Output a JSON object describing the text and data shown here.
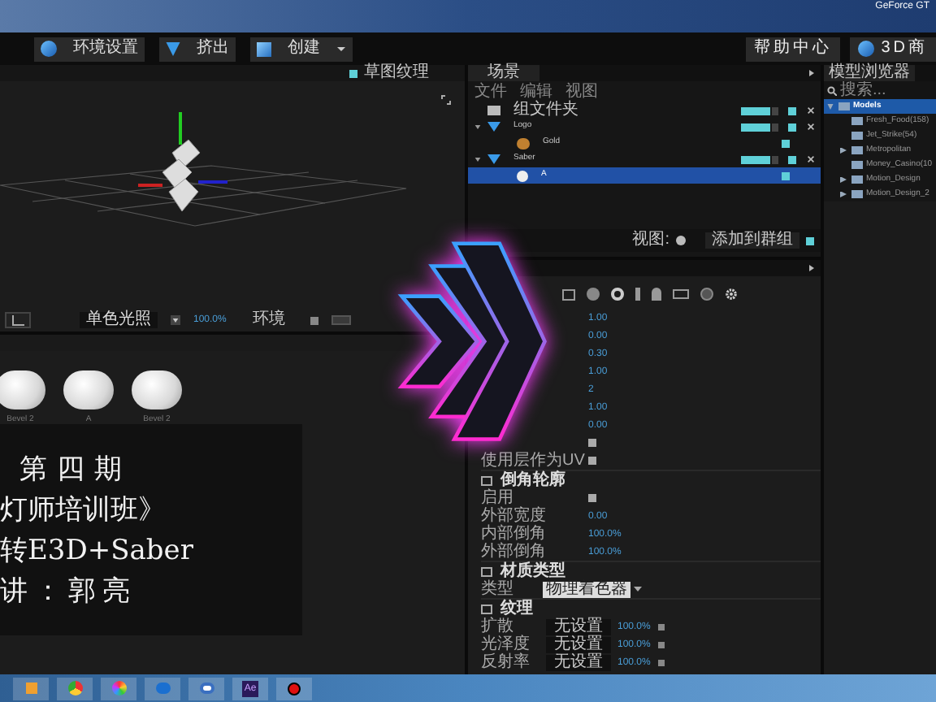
{
  "desktop": {
    "corner_text": "GeForce GT"
  },
  "toolbar": {
    "left_buttons": [
      {
        "label": "环境设置",
        "kind": "globe",
        "dropdown": false
      },
      {
        "label": "挤出",
        "kind": "gem",
        "dropdown": false
      },
      {
        "label": "创建",
        "kind": "cube",
        "dropdown": true
      }
    ],
    "right_buttons": [
      {
        "label": "帮助中心",
        "kind": "plain"
      },
      {
        "label": "3D商",
        "kind": "globe"
      }
    ]
  },
  "viewport": {
    "header_label": "草图纹理",
    "header_checked": true,
    "shading": "单色光照",
    "zoom": "100.0%",
    "environment_label": "环境",
    "environment_checked": true
  },
  "materials": [
    {
      "label": "Bevel 2"
    },
    {
      "label": "A"
    },
    {
      "label": "Bevel 2"
    }
  ],
  "overlay_text": [
    "第四期",
    "灯师培训班》",
    "转E3D+Saber",
    "讲：郭亮"
  ],
  "scene": {
    "tab": "场景",
    "menu": [
      "文件",
      "编辑",
      "视图"
    ],
    "tree": [
      {
        "label": "组文件夹",
        "kind": "folder",
        "selected": false,
        "toggles": true,
        "visible": true
      },
      {
        "label": "Logo",
        "kind": "model",
        "selected": false,
        "toggles": true,
        "visible": true,
        "children": [
          {
            "label": "Gold",
            "kind": "material",
            "selected": false,
            "toggles": false,
            "visible": true
          }
        ]
      },
      {
        "label": "Saber",
        "kind": "model",
        "selected": false,
        "toggles": true,
        "visible": true,
        "children": [
          {
            "label": "A",
            "kind": "sphere",
            "selected": true,
            "toggles": false,
            "visible": true
          }
        ]
      }
    ],
    "view_label": "视图:",
    "add_group": "添加到群组",
    "add_group_checked": true
  },
  "properties": [
    {
      "kind": "value",
      "value": "1.00"
    },
    {
      "kind": "value",
      "value": "0.00"
    },
    {
      "kind": "value",
      "value": "0.30"
    },
    {
      "kind": "value",
      "value": "1.00"
    },
    {
      "kind": "value",
      "value": "2"
    },
    {
      "kind": "value",
      "value": "1.00"
    },
    {
      "kind": "value",
      "value": "0.00"
    },
    {
      "kind": "check",
      "checked": true
    },
    {
      "kind": "check",
      "label": "使用层作为UV",
      "checked": true
    },
    {
      "kind": "section",
      "label": "倒角轮廓"
    },
    {
      "kind": "check",
      "label": "启用",
      "checked": true
    },
    {
      "kind": "value",
      "label": "外部宽度",
      "value": "0.00"
    },
    {
      "kind": "value",
      "label": "内部倒角",
      "value": "100.0%"
    },
    {
      "kind": "value",
      "label": "外部倒角",
      "value": "100.0%"
    },
    {
      "kind": "section",
      "label": "材质类型"
    },
    {
      "kind": "dropdown",
      "label": "类型",
      "value": "物理着色器"
    },
    {
      "kind": "section",
      "label": "纹理"
    },
    {
      "kind": "texture",
      "label": "扩散",
      "value": "无设置",
      "amount": "100.0%",
      "checked": true
    },
    {
      "kind": "texture",
      "label": "光泽度",
      "value": "无设置",
      "amount": "100.0%",
      "checked": true
    },
    {
      "kind": "texture",
      "label": "反射率",
      "value": "无设置",
      "amount": "100.0%",
      "checked": true
    }
  ],
  "model_browser": {
    "tab": "模型浏览器",
    "search_placeholder": "搜索...",
    "tree": [
      {
        "label": "Models",
        "expandable": true,
        "expanded": true,
        "selected": true,
        "children": [
          {
            "label": "Fresh_Food(158)",
            "expandable": false,
            "selected": false
          },
          {
            "label": "Jet_Strike(54)",
            "expandable": false,
            "selected": false
          },
          {
            "label": "Metropolitan",
            "expandable": true,
            "expanded": false,
            "selected": false
          },
          {
            "label": "Money_Casino(10",
            "expandable": false,
            "selected": false
          },
          {
            "label": "Motion_Design",
            "expandable": true,
            "expanded": false,
            "selected": false
          },
          {
            "label": "Motion_Design_2",
            "expandable": true,
            "expanded": false,
            "selected": false
          }
        ]
      }
    ]
  },
  "taskbar": [
    {
      "kind": "media"
    },
    {
      "kind": "browser"
    },
    {
      "kind": "pinwheel"
    },
    {
      "kind": "player"
    },
    {
      "kind": "cloud"
    },
    {
      "kind": "ae",
      "label": "Ae"
    },
    {
      "kind": "record"
    }
  ]
}
